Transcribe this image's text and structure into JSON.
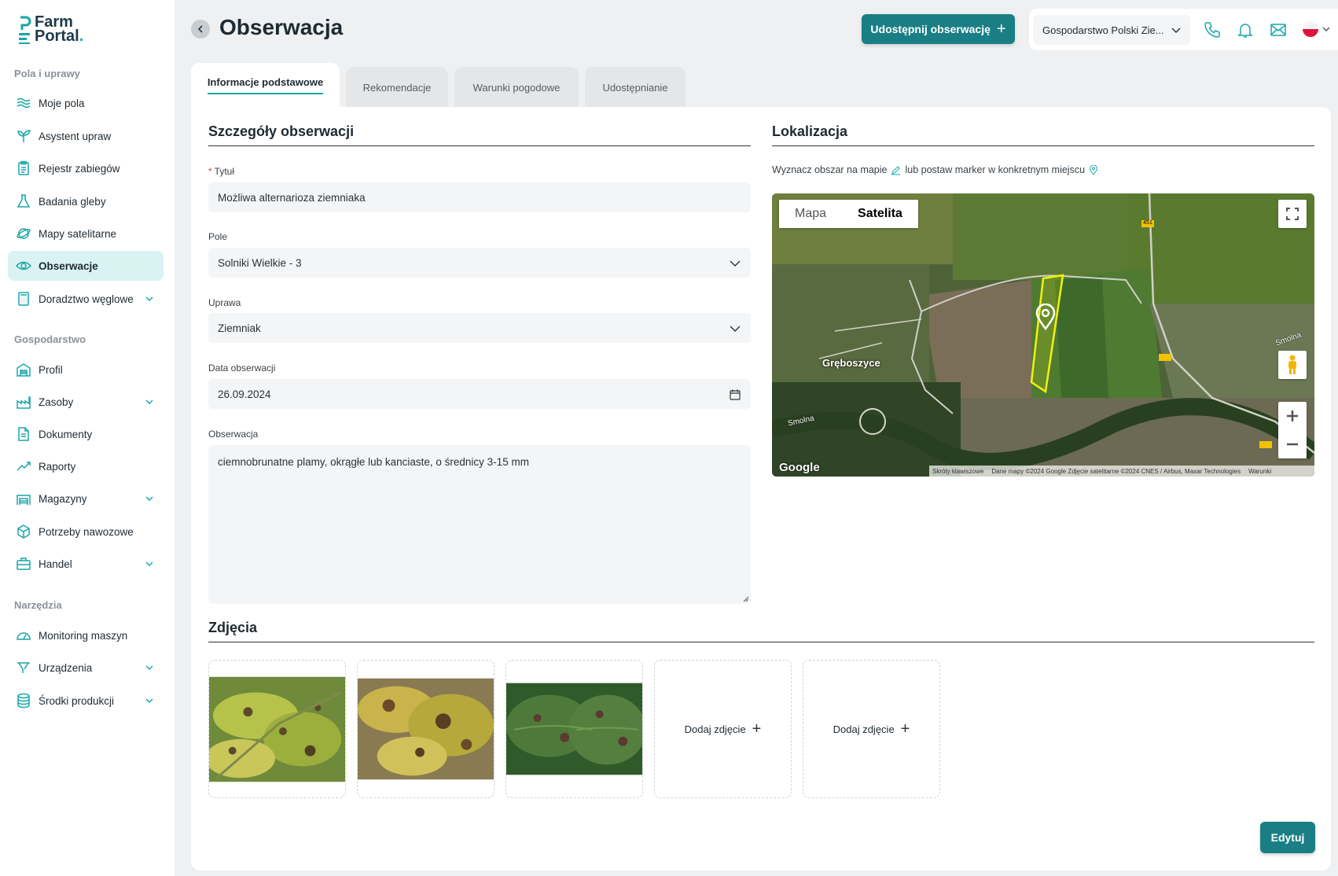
{
  "logo": {
    "line1": "Farm",
    "line2": "Portal",
    "dot": "."
  },
  "sidebar": {
    "sections": [
      "Pola i uprawy",
      "Gospodarstwo",
      "Narzędzia"
    ],
    "items": [
      {
        "label": "Moje pola",
        "icon": "fields-icon"
      },
      {
        "label": "Asystent upraw",
        "icon": "sprout-icon"
      },
      {
        "label": "Rejestr zabiegów",
        "icon": "clipboard-icon"
      },
      {
        "label": "Badania gleby",
        "icon": "flask-icon"
      },
      {
        "label": "Mapy satelitarne",
        "icon": "satellite-icon"
      },
      {
        "label": "Obserwacje",
        "icon": "eye-icon",
        "active": true
      },
      {
        "label": "Doradztwo węglowe",
        "icon": "calculator-icon",
        "expandable": true
      },
      {
        "label": "Profil",
        "icon": "barn-icon"
      },
      {
        "label": "Zasoby",
        "icon": "factory-icon",
        "expandable": true
      },
      {
        "label": "Dokumenty",
        "icon": "document-icon"
      },
      {
        "label": "Raporty",
        "icon": "trend-icon"
      },
      {
        "label": "Magazyny",
        "icon": "warehouse-icon",
        "expandable": true
      },
      {
        "label": "Potrzeby nawozowe",
        "icon": "fertilizer-icon"
      },
      {
        "label": "Handel",
        "icon": "briefcase-icon",
        "expandable": true
      },
      {
        "label": "Monitoring maszyn",
        "icon": "gauge-icon"
      },
      {
        "label": "Urządzenia",
        "icon": "device-icon",
        "expandable": true
      },
      {
        "label": "Środki produkcji",
        "icon": "database-icon",
        "expandable": true
      }
    ]
  },
  "header": {
    "title": "Obserwacja",
    "share_label": "Udostępnij obserwację",
    "farm_select": "Gospodarstwo Polski Zie..."
  },
  "tabs": [
    "Informacje podstawowe",
    "Rekomendacje",
    "Warunki pogodowe",
    "Udostępnianie"
  ],
  "details": {
    "title": "Szczegóły obserwacji",
    "title_label": "Tytuł",
    "title_value": "Możliwa alternarioza ziemniaka",
    "field_label": "Pole",
    "field_value": "Solniki Wielkie - 3",
    "crop_label": "Uprawa",
    "crop_value": "Ziemniak",
    "date_label": "Data obserwacji",
    "date_value": "26.09.2024",
    "obs_label": "Obserwacja",
    "obs_value": "ciemnobrunatne plamy, okrągłe lub kanciaste, o średnicy 3-15 mm"
  },
  "location": {
    "title": "Lokalizacja",
    "hint_part1": "Wyznacz obszar na mapie",
    "hint_part2": "lub postaw marker w konkretnym miejscu",
    "map_type_map": "Mapa",
    "map_type_sat": "Satelita",
    "place_label": "Grębоszyce",
    "river1": "Smolna",
    "river2": "Smolna",
    "road": "451",
    "google": "Google",
    "footer_shortcuts": "Skróty klawiszowe",
    "footer_data": "Dane mapy ©2024 Google Zdjęcie satelitarne ©2024 CNES / Airbus, Maxar Technologies",
    "footer_terms": "Warunki"
  },
  "photos": {
    "title": "Zdjęcia",
    "add_label": "Dodaj zdjęcie"
  },
  "edit_label": "Edytuj",
  "colors": {
    "accent": "#1a7f84",
    "active_bg": "#d9f3f3",
    "teal": "#1aa6a8"
  }
}
